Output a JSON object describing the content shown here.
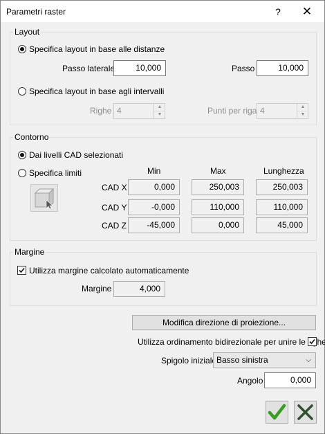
{
  "window": {
    "title": "Parametri raster",
    "help": "?",
    "close": "✕"
  },
  "layout": {
    "label": "Layout",
    "opt_distances": "Specifica layout in base alle distanze",
    "passo_laterale_label": "Passo laterale",
    "passo_laterale_value": "10,000",
    "passo_label": "Passo",
    "passo_value": "10,000",
    "opt_intervals": "Specifica layout in base agli intervalli",
    "righe_label": "Righe",
    "righe_value": "4",
    "punti_label": "Punti per riga",
    "punti_value": "4"
  },
  "contorno": {
    "label": "Contorno",
    "opt_cad": "Dai livelli CAD selezionati",
    "opt_limits": "Specifica limiti",
    "headers": {
      "min": "Min",
      "max": "Max",
      "length": "Lunghezza"
    },
    "rows": [
      {
        "label": "CAD X",
        "min": "0,000",
        "max": "250,003",
        "length": "250,003"
      },
      {
        "label": "CAD Y",
        "min": "-0,000",
        "max": "110,000",
        "length": "110,000"
      },
      {
        "label": "CAD Z",
        "min": "-45,000",
        "max": "0,000",
        "length": "45,000"
      }
    ]
  },
  "margine": {
    "label": "Margine",
    "auto_label": "Utilizza margine calcolato automaticamente",
    "margine_label": "Margine",
    "margine_value": "4,000"
  },
  "projection_button": "Modifica direzione di proiezione...",
  "bidirectional_label": "Utilizza ordinamento bidirezionale per unire le righe",
  "spigolo_label": "Spigolo iniziale",
  "spigolo_value": "Basso sinistra",
  "angolo_label": "Angolo",
  "angolo_value": "0,000",
  "colors": {
    "ok": "#3a9d23",
    "cancel": "#2f4f2f"
  }
}
